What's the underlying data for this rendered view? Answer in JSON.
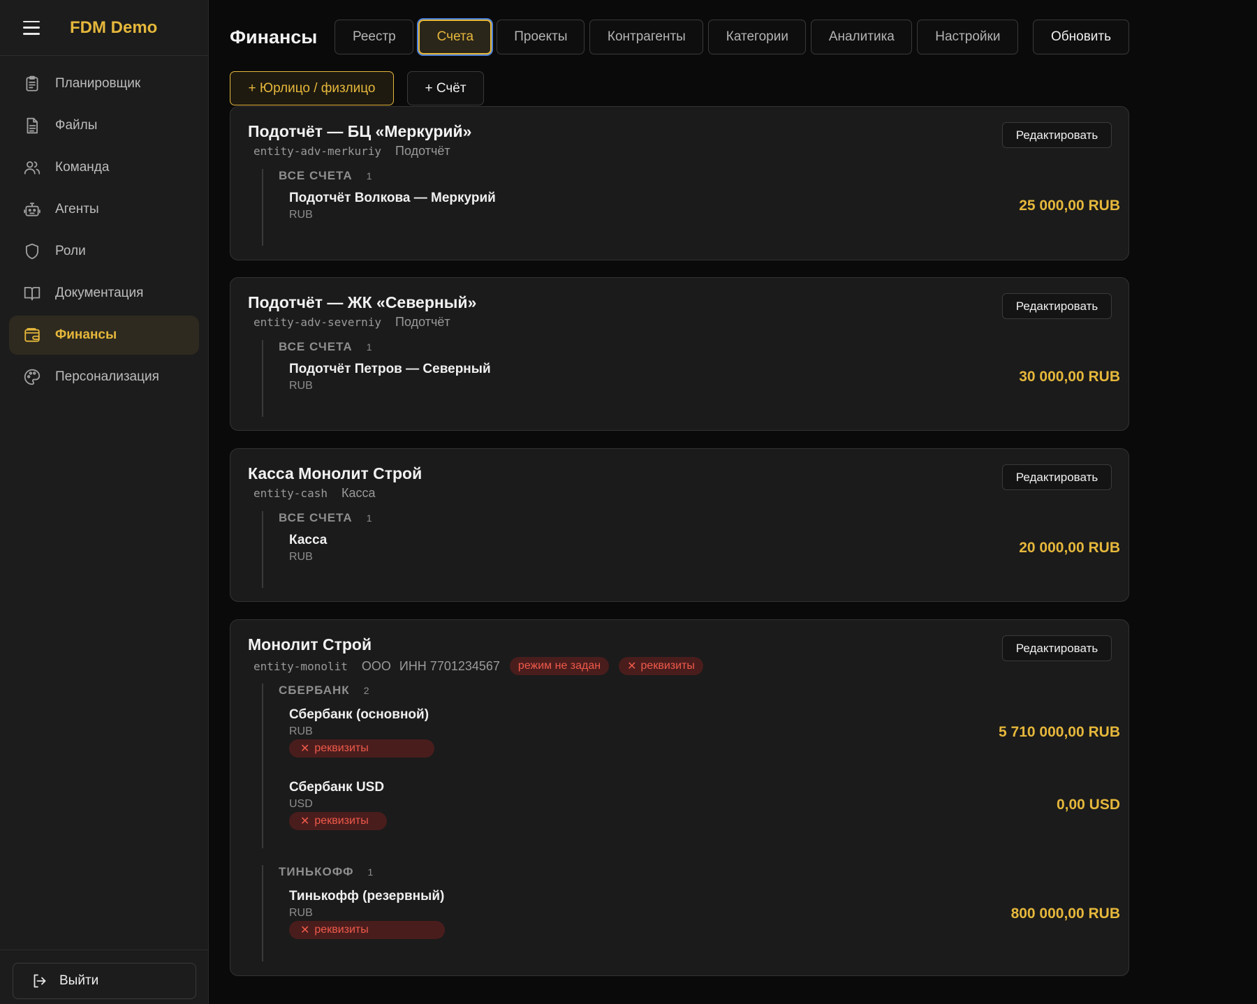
{
  "app": {
    "brand": "FDM Demo"
  },
  "sidebar": {
    "items": [
      {
        "label": "Планировщик",
        "icon": "clipboard-icon"
      },
      {
        "label": "Файлы",
        "icon": "file-icon"
      },
      {
        "label": "Команда",
        "icon": "users-icon"
      },
      {
        "label": "Агенты",
        "icon": "bot-icon"
      },
      {
        "label": "Роли",
        "icon": "shield-icon"
      },
      {
        "label": "Документация",
        "icon": "book-icon"
      },
      {
        "label": "Финансы",
        "icon": "wallet-icon",
        "active": true
      },
      {
        "label": "Персонализация",
        "icon": "palette-icon"
      }
    ],
    "logout_label": "Выйти"
  },
  "header": {
    "title": "Финансы",
    "tabs": [
      "Реестр",
      "Счета",
      "Проекты",
      "Контрагенты",
      "Категории",
      "Аналитика",
      "Настройки"
    ],
    "active_tab": "Счета",
    "refresh_label": "Обновить"
  },
  "actions": {
    "add_entity": "+ Юрлицо / физлицо",
    "add_account": "+ Счёт"
  },
  "edit_label": "Редактировать",
  "colors": {
    "accent": "#e5b73b",
    "danger": "#ef5a4a",
    "danger_bg": "#4a1d1d",
    "background": "#0a0a0a",
    "card": "#1b1b1b"
  },
  "entities": [
    {
      "title": "Подотчёт — БЦ «Меркурий»",
      "slug": "entity-adv-merkuriy",
      "kind": "Подотчёт",
      "groups": [
        {
          "name": "ВСЕ СЧЕТА",
          "count": "1",
          "accounts": [
            {
              "name": "Подотчёт Волкова — Меркурий",
              "currency": "RUB",
              "amount": "25 000,00 RUB"
            }
          ]
        }
      ]
    },
    {
      "title": "Подотчёт — ЖК «Северный»",
      "slug": "entity-adv-severniy",
      "kind": "Подотчёт",
      "groups": [
        {
          "name": "ВСЕ СЧЕТА",
          "count": "1",
          "accounts": [
            {
              "name": "Подотчёт Петров — Северный",
              "currency": "RUB",
              "amount": "30 000,00 RUB"
            }
          ]
        }
      ]
    },
    {
      "title": "Касса Монолит Строй",
      "slug": "entity-cash",
      "kind": "Касса",
      "groups": [
        {
          "name": "ВСЕ СЧЕТА",
          "count": "1",
          "accounts": [
            {
              "name": "Касса",
              "currency": "RUB",
              "amount": "20 000,00 RUB"
            }
          ]
        }
      ]
    },
    {
      "title": "Монолит Строй",
      "slug": "entity-monolit",
      "kind": "ООО",
      "inn": "ИНН 7701234567",
      "badges": [
        "режим не задан",
        "реквизиты"
      ],
      "groups": [
        {
          "name": "СБЕРБАНК",
          "count": "2",
          "accounts": [
            {
              "name": "Сбербанк (основной)",
              "currency": "RUB",
              "amount": "5 710 000,00 RUB",
              "badge": "реквизиты"
            },
            {
              "name": "Сбербанк USD",
              "currency": "USD",
              "amount": "0,00 USD",
              "badge": "реквизиты"
            }
          ]
        },
        {
          "name": "ТИНЬКОФФ",
          "count": "1",
          "accounts": [
            {
              "name": "Тинькофф (резервный)",
              "currency": "RUB",
              "amount": "800 000,00 RUB",
              "badge": "реквизиты"
            }
          ]
        }
      ]
    }
  ]
}
